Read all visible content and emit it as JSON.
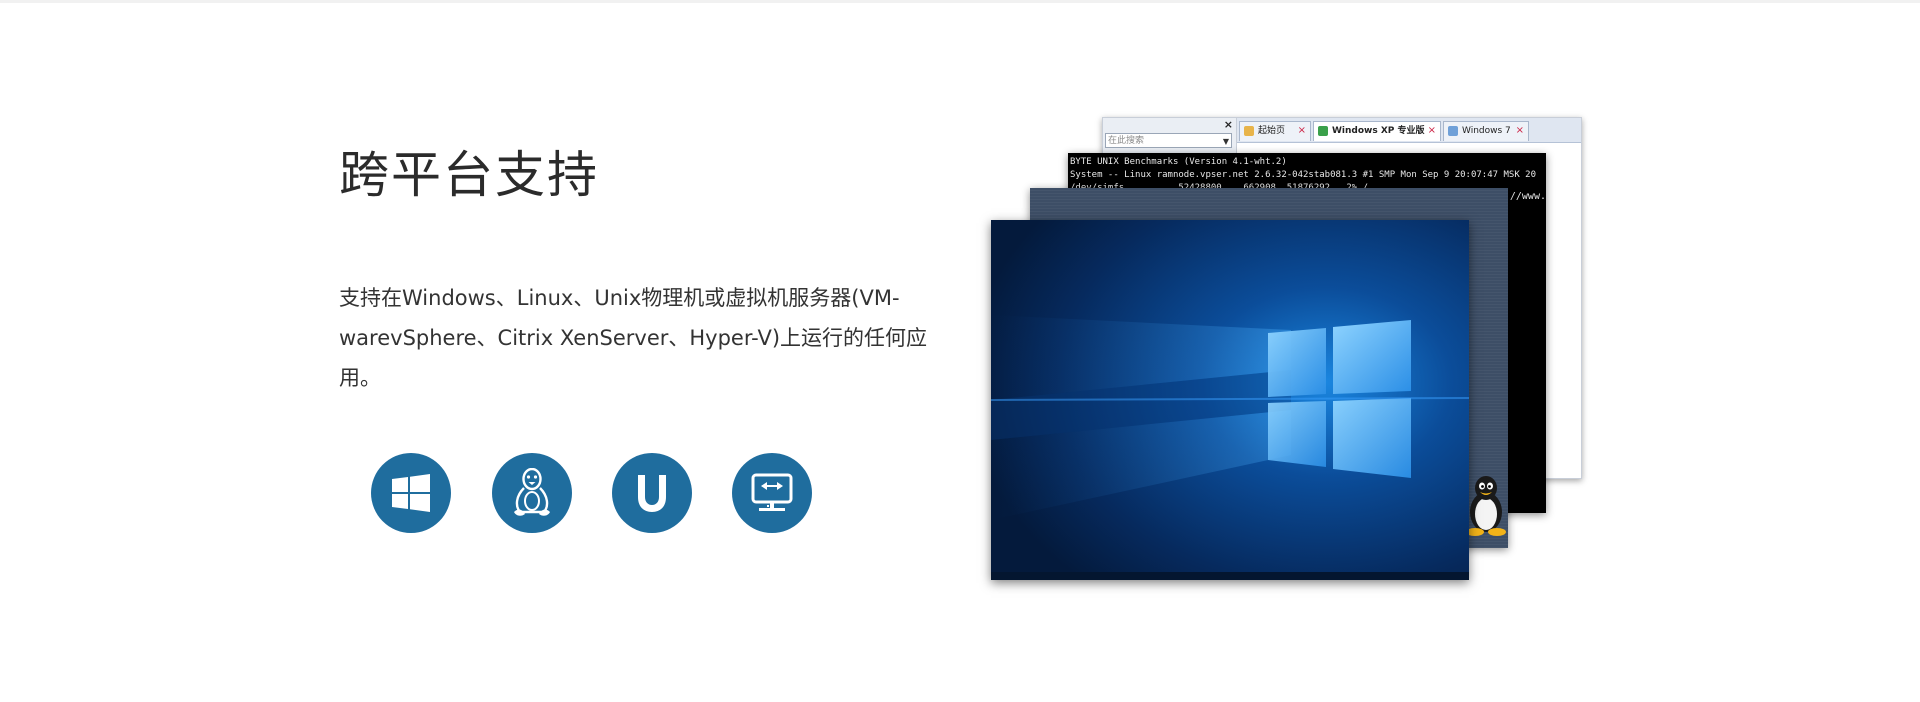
{
  "section": {
    "title": "跨平台支持",
    "description_line1": "支持在Windows、Linux、Unix物理机或虚拟机服务器(VM-",
    "description_line2": "warevSphere、Citrix XenServer、Hyper-V)上运行的任何应用。"
  },
  "platform_icons": [
    {
      "name": "windows-icon"
    },
    {
      "name": "linux-icon"
    },
    {
      "name": "unix-icon"
    },
    {
      "name": "virtualization-icon"
    }
  ],
  "colors": {
    "accent": "#1f6d9e",
    "title_text": "#2b2b2b",
    "body_text": "#333333"
  },
  "screenshots": {
    "xp_browser": {
      "close_glyph": "×",
      "search_placeholder": "在此搜索",
      "tabs": [
        {
          "label": "起始页",
          "close": "×"
        },
        {
          "label": "Windows XP 专业版",
          "close": "×"
        },
        {
          "label": "Windows 7",
          "close": "×"
        }
      ]
    },
    "terminal": {
      "line1": "BYTE UNIX Benchmarks (Version 4.1-wht.2)",
      "line2": "System -- Linux ramnode.vpser.net 2.6.32-042stab081.3 #1 SMP Mon Sep 9 20:07:47 MSK 20",
      "line3": "/dev/simfs          52428800    662908  51876292   2% /",
      "url_fragment": "://www."
    }
  }
}
